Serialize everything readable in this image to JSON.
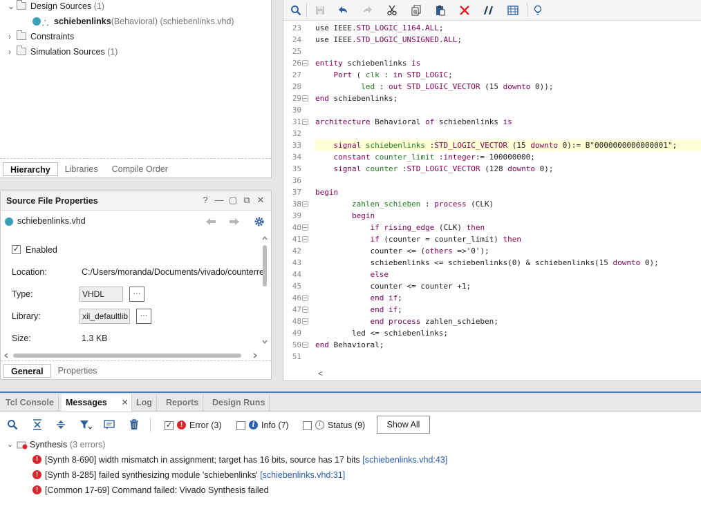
{
  "hierarchy": {
    "design_sources": {
      "label": "Design Sources",
      "count": "(1)"
    },
    "top_module": {
      "name": "schiebenlinks",
      "detail": "(Behavioral) (schiebenlinks.vhd)"
    },
    "constraints": {
      "label": "Constraints"
    },
    "simulation_sources": {
      "label": "Simulation Sources",
      "count": "(1)"
    },
    "tabs": [
      "Hierarchy",
      "Libraries",
      "Compile Order"
    ]
  },
  "props": {
    "title": "Source File Properties",
    "header_buttons": {
      "help": "?",
      "min": "—",
      "restore": "▢",
      "float": "⧉",
      "close": "✕"
    },
    "file_name": "schiebenlinks.vhd",
    "enabled_label": "Enabled",
    "location_label": "Location:",
    "location_value": "C:/Users/moranda/Documents/vivado/counterre",
    "type_label": "Type:",
    "type_value": "VHDL",
    "library_label": "Library:",
    "library_value": "xil_defaultlib",
    "size_label": "Size:",
    "size_value": "1.3 KB",
    "dots": "···",
    "tabs": [
      "General",
      "Properties"
    ]
  },
  "editor": {
    "lines": [
      {
        "n": "23",
        "segs": [
          [
            "t",
            "use IEEE."
          ],
          [
            "k",
            "STD_LOGIC_1164"
          ],
          [
            "t",
            "."
          ],
          [
            "k",
            "ALL"
          ],
          [
            "t",
            ";"
          ]
        ]
      },
      {
        "n": "24",
        "segs": [
          [
            "t",
            "use IEEE."
          ],
          [
            "k",
            "STD_LOGIC_UNSIGNED"
          ],
          [
            "t",
            "."
          ],
          [
            "k",
            "ALL"
          ],
          [
            "t",
            ";"
          ]
        ]
      },
      {
        "n": "25",
        "segs": []
      },
      {
        "n": "26",
        "fold": true,
        "segs": [
          [
            "k",
            "entity"
          ],
          [
            "t",
            " schiebenlinks "
          ],
          [
            "k",
            "is"
          ]
        ]
      },
      {
        "n": "27",
        "segs": [
          [
            "t",
            "    "
          ],
          [
            "k",
            "Port"
          ],
          [
            "t",
            " ( "
          ],
          [
            "i",
            "clk"
          ],
          [
            "t",
            " : "
          ],
          [
            "k",
            "in"
          ],
          [
            "t",
            " "
          ],
          [
            "k",
            "STD_LOGIC"
          ],
          [
            "t",
            ";"
          ]
        ]
      },
      {
        "n": "28",
        "segs": [
          [
            "t",
            "          "
          ],
          [
            "i",
            "led"
          ],
          [
            "t",
            " : "
          ],
          [
            "k",
            "out"
          ],
          [
            "t",
            " "
          ],
          [
            "k",
            "STD_LOGIC_VECTOR"
          ],
          [
            "t",
            " (15 "
          ],
          [
            "k",
            "downto"
          ],
          [
            "t",
            " 0));"
          ]
        ]
      },
      {
        "n": "29",
        "fold": true,
        "segs": [
          [
            "k",
            "end"
          ],
          [
            "t",
            " schiebenlinks;"
          ]
        ]
      },
      {
        "n": "30",
        "segs": []
      },
      {
        "n": "31",
        "fold": true,
        "segs": [
          [
            "k",
            "architecture"
          ],
          [
            "t",
            " Behavioral "
          ],
          [
            "k",
            "of"
          ],
          [
            "t",
            " schiebenlinks "
          ],
          [
            "k",
            "is"
          ]
        ]
      },
      {
        "n": "32",
        "segs": []
      },
      {
        "n": "33",
        "hl": true,
        "segs": [
          [
            "t",
            "    "
          ],
          [
            "k",
            "signal"
          ],
          [
            "t",
            " "
          ],
          [
            "i",
            "schiebenlinks"
          ],
          [
            "t",
            " :"
          ],
          [
            "k",
            "STD_LOGIC_VECTOR"
          ],
          [
            "t",
            " (15 "
          ],
          [
            "k",
            "downto"
          ],
          [
            "t",
            " 0):= B\"0000000000000001\";"
          ]
        ]
      },
      {
        "n": "34",
        "segs": [
          [
            "t",
            "    "
          ],
          [
            "k",
            "constant"
          ],
          [
            "t",
            " "
          ],
          [
            "i",
            "counter_limit"
          ],
          [
            "t",
            " :"
          ],
          [
            "k",
            "integer"
          ],
          [
            "t",
            ":= 100000000;"
          ]
        ]
      },
      {
        "n": "35",
        "segs": [
          [
            "t",
            "    "
          ],
          [
            "k",
            "signal"
          ],
          [
            "t",
            " "
          ],
          [
            "i",
            "counter"
          ],
          [
            "t",
            " :"
          ],
          [
            "k",
            "STD_LOGIC_VECTOR"
          ],
          [
            "t",
            " (128 "
          ],
          [
            "k",
            "downto"
          ],
          [
            "t",
            " 0);"
          ]
        ]
      },
      {
        "n": "36",
        "segs": []
      },
      {
        "n": "37",
        "segs": [
          [
            "k",
            "begin"
          ]
        ]
      },
      {
        "n": "38",
        "fold": true,
        "segs": [
          [
            "t",
            "        "
          ],
          [
            "i",
            "zahlen_schieben"
          ],
          [
            "t",
            " : "
          ],
          [
            "k",
            "process"
          ],
          [
            "t",
            " (CLK)"
          ]
        ]
      },
      {
        "n": "39",
        "segs": [
          [
            "t",
            "        "
          ],
          [
            "k",
            "begin"
          ]
        ]
      },
      {
        "n": "40",
        "fold": true,
        "segs": [
          [
            "t",
            "            "
          ],
          [
            "k",
            "if"
          ],
          [
            "t",
            " "
          ],
          [
            "k",
            "rising_edge"
          ],
          [
            "t",
            " (CLK) "
          ],
          [
            "k",
            "then"
          ]
        ]
      },
      {
        "n": "41",
        "fold": true,
        "segs": [
          [
            "t",
            "            "
          ],
          [
            "k",
            "if"
          ],
          [
            "t",
            " (counter = counter_limit) "
          ],
          [
            "k",
            "then"
          ]
        ]
      },
      {
        "n": "42",
        "segs": [
          [
            "t",
            "            counter <= ("
          ],
          [
            "k",
            "others"
          ],
          [
            "t",
            " =>'0');"
          ]
        ]
      },
      {
        "n": "43",
        "segs": [
          [
            "t",
            "            schiebenlinks <= schiebenlinks(0) & schiebenlinks(15 "
          ],
          [
            "k",
            "downto"
          ],
          [
            "t",
            " 0);"
          ]
        ]
      },
      {
        "n": "44",
        "segs": [
          [
            "t",
            "            "
          ],
          [
            "k",
            "else"
          ]
        ]
      },
      {
        "n": "45",
        "segs": [
          [
            "t",
            "            counter <= counter +1;"
          ]
        ]
      },
      {
        "n": "46",
        "fold": true,
        "segs": [
          [
            "t",
            "            "
          ],
          [
            "k",
            "end if"
          ],
          [
            "t",
            ";"
          ]
        ]
      },
      {
        "n": "47",
        "fold": true,
        "segs": [
          [
            "t",
            "            "
          ],
          [
            "k",
            "end if"
          ],
          [
            "t",
            ";"
          ]
        ]
      },
      {
        "n": "48",
        "fold": true,
        "segs": [
          [
            "t",
            "            "
          ],
          [
            "k",
            "end process"
          ],
          [
            "t",
            " zahlen_schieben;"
          ]
        ]
      },
      {
        "n": "49",
        "segs": [
          [
            "t",
            "        led <= schiebenlinks;"
          ]
        ]
      },
      {
        "n": "50",
        "fold": true,
        "segs": [
          [
            "k",
            "end"
          ],
          [
            "t",
            " Behavioral;"
          ]
        ]
      },
      {
        "n": "51",
        "segs": []
      }
    ],
    "scroll_left": "<"
  },
  "messages": {
    "tabs": [
      "Tcl Console",
      "Messages",
      "Log",
      "Reports",
      "Design Runs"
    ],
    "close_x": "✕",
    "filters": {
      "error": {
        "label": "Error (3)",
        "checked": true
      },
      "info": {
        "label": "Info (7)",
        "checked": false
      },
      "status": {
        "label": "Status (9)",
        "checked": false
      },
      "show_all": "Show All"
    },
    "group": {
      "label": "Synthesis",
      "count": "(3 errors)"
    },
    "items": [
      {
        "text": "[Synth 8-690] width mismatch in assignment; target has 16 bits, source has 17 bits ",
        "link": "[schiebenlinks.vhd:43]"
      },
      {
        "text": "[Synth 8-285] failed synthesizing module 'schiebenlinks' ",
        "link": "[schiebenlinks.vhd:31]"
      },
      {
        "text": "[Common 17-69] Command failed: Vivado Synthesis failed",
        "link": ""
      }
    ]
  }
}
